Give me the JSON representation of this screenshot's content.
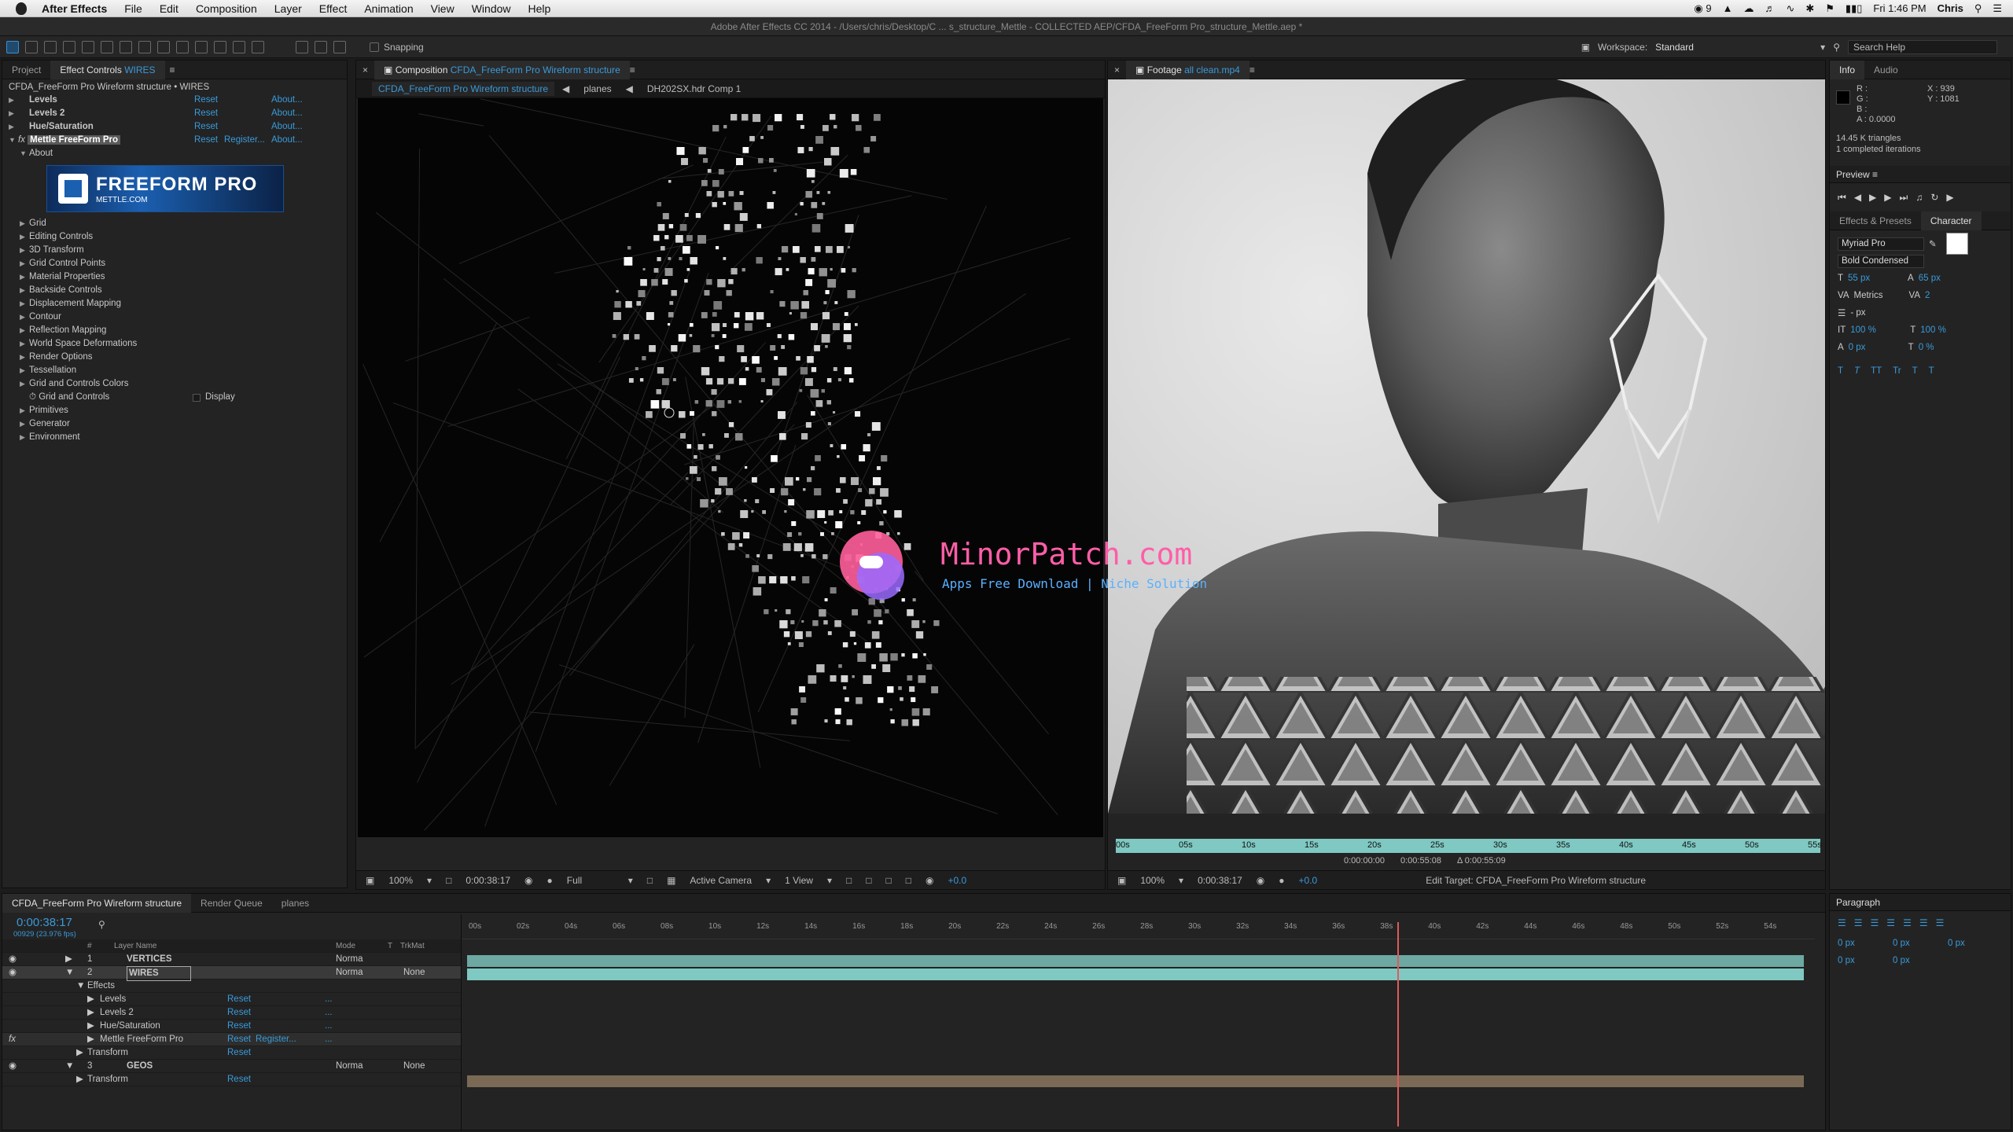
{
  "menubar": {
    "app_name": "After Effects",
    "items": [
      "File",
      "Edit",
      "Composition",
      "Layer",
      "Effect",
      "Animation",
      "View",
      "Window",
      "Help"
    ],
    "status_count": "9",
    "time": "Fri 1:46 PM",
    "user": "Chris"
  },
  "window_title": "Adobe After Effects CC 2014 - /Users/chris/Desktop/C ... s_structure_Mettle - COLLECTED AEP/CFDA_FreeForm Pro_structure_Mettle.aep *",
  "toolbar": {
    "snapping_label": "Snapping",
    "workspace_label": "Workspace:",
    "workspace_value": "Standard",
    "search_placeholder": "Search Help"
  },
  "left_panel": {
    "tabs": [
      {
        "label": "Project"
      },
      {
        "label": "Effect Controls",
        "suffix": "WIRES"
      }
    ],
    "header": "CFDA_FreeForm Pro Wireform structure • WIRES",
    "effects": [
      {
        "name": "Levels",
        "reset": "Reset",
        "about": "About..."
      },
      {
        "name": "Levels 2",
        "reset": "Reset",
        "about": "About..."
      },
      {
        "name": "Hue/Saturation",
        "reset": "Reset",
        "about": "About..."
      },
      {
        "name": "Mettle FreeForm Pro",
        "reset": "Reset",
        "register": "Register...",
        "about": "About..."
      }
    ],
    "about_label": "About",
    "banner_text": "FREEFORM PRO",
    "banner_sub": "METTLE.COM",
    "groups": [
      "Grid",
      "Editing Controls",
      "3D Transform",
      "Grid Control Points",
      "Material Properties",
      "Backside Controls",
      "Displacement Mapping",
      "Contour",
      "Reflection Mapping",
      "World Space Deformations",
      "Render Options",
      "Tessellation",
      "Grid and Controls Colors"
    ],
    "grid_controls_label": "Grid and Controls",
    "grid_controls_value": "Display",
    "groups2": [
      "Primitives",
      "Generator",
      "Environment"
    ]
  },
  "comp_panel": {
    "tab_prefix": "Composition",
    "tab_name": "CFDA_FreeForm Pro Wireform structure",
    "crumbs": [
      "CFDA_FreeForm Pro Wireform structure",
      "planes",
      "DH202SX.hdr Comp 1"
    ],
    "footer": {
      "zoom": "100%",
      "timecode": "0:00:38:17",
      "resolution": "Full",
      "camera": "Active Camera",
      "views": "1 View",
      "exposure": "+0.0"
    }
  },
  "footage_panel": {
    "tab_prefix": "Footage",
    "tab_name": "all clean.mp4",
    "ruler_labels": [
      "00s",
      "05s",
      "10s",
      "15s",
      "20s",
      "25s",
      "30s",
      "35s",
      "40s",
      "45s",
      "50s",
      "55s"
    ],
    "in_time": "0:00:00:00",
    "out_time": "0:00:55:08",
    "duration": "Δ 0:00:55:09",
    "footer": {
      "zoom": "100%",
      "timecode": "0:00:38:17",
      "exposure": "+0.0",
      "edit_target": "Edit Target: CFDA_FreeForm Pro Wireform structure"
    }
  },
  "info_panel": {
    "tabs": [
      "Info",
      "Audio"
    ],
    "r": "R :",
    "g": "G :",
    "b": "B :",
    "a": "A : 0.0000",
    "x": "X : 939",
    "y": "Y : 1081",
    "triangles": "14.45 K triangles",
    "iterations": "1 completed iterations"
  },
  "preview_panel": {
    "title": "Preview"
  },
  "character_panel": {
    "tabs": [
      "Effects & Presets",
      "Character"
    ],
    "font": "Myriad Pro",
    "style": "Bold Condensed",
    "size": "55 px",
    "leading": "65 px",
    "kerning": "Metrics",
    "tracking": "2",
    "indent": "- px",
    "vscale": "100 %",
    "hscale": "100 %",
    "baseline": "0 px",
    "tsume": "0 %",
    "style_buttons": [
      "T",
      "T",
      "TT",
      "Tr",
      "T",
      "T"
    ]
  },
  "timeline": {
    "tabs": [
      "CFDA_FreeForm Pro Wireform structure",
      "Render Queue",
      "planes"
    ],
    "timecode": "0:00:38:17",
    "frame_info": "00929 (23.976 fps)",
    "column_headers": {
      "num": "#",
      "layer_name": "Layer Name",
      "mode": "Mode",
      "t": "T",
      "trkmat": "TrkMat"
    },
    "layers": [
      {
        "num": "1",
        "name": "VERTICES",
        "mode": "Norma",
        "trkmat": ""
      },
      {
        "num": "2",
        "name": "WIRES",
        "mode": "Norma",
        "trkmat": "None"
      }
    ],
    "effects_label": "Effects",
    "effect_rows": [
      {
        "name": "Levels",
        "reset": "Reset",
        "dots": "..."
      },
      {
        "name": "Levels 2",
        "reset": "Reset",
        "dots": "..."
      },
      {
        "name": "Hue/Saturation",
        "reset": "Reset",
        "dots": "..."
      },
      {
        "name": "Mettle FreeForm Pro",
        "reset": "Reset",
        "register": "Register...",
        "dots": "..."
      }
    ],
    "transform_label": "Transform",
    "transform_reset": "Reset",
    "layer3": {
      "num": "3",
      "name": "GEOS",
      "mode": "Norma",
      "trkmat": "None"
    },
    "ruler_labels": [
      "00s",
      "02s",
      "04s",
      "06s",
      "08s",
      "10s",
      "12s",
      "14s",
      "16s",
      "18s",
      "20s",
      "22s",
      "24s",
      "26s",
      "28s",
      "30s",
      "32s",
      "34s",
      "36s",
      "38s",
      "40s",
      "42s",
      "44s",
      "46s",
      "48s",
      "50s",
      "52s",
      "54s"
    ],
    "playhead_seconds": 38.7,
    "duration_seconds": 55.4
  },
  "paragraph_panel": {
    "title": "Paragraph",
    "indent_left": "0 px",
    "indent_right": "0 px",
    "indent_first": "0 px",
    "space_before": "0 px",
    "space_after": "0 px"
  },
  "watermark": {
    "title": "MinorPatch.com",
    "subtitle": "Apps Free Download | Niche Solution"
  },
  "colors": {
    "accent": "#3a9ad9",
    "timeline_bar": "#7fc9c2",
    "geos_bar": "#7a6a55",
    "playhead": "#e05a5a"
  }
}
